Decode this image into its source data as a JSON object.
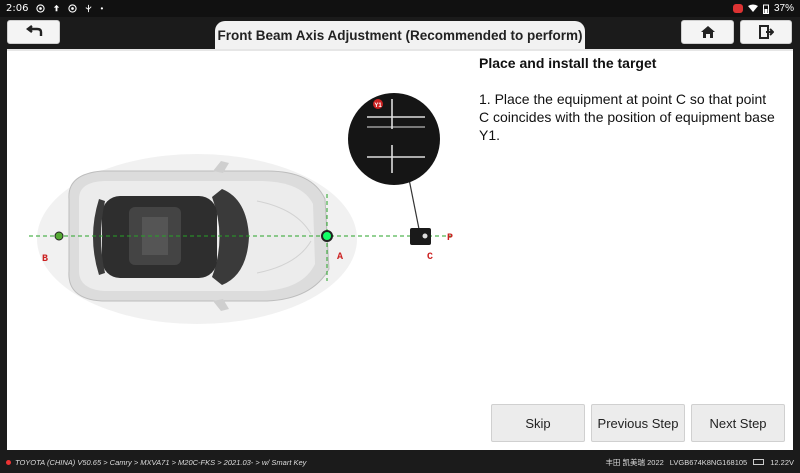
{
  "status_bar": {
    "time": "2:06",
    "battery": "37%"
  },
  "header": {
    "title": "Front Beam Axis Adjustment (Recommended to perform)"
  },
  "instructions": {
    "title": "Place and install the target",
    "text": "1. Place the equipment at point C so that point C coincides with the position of equipment base Y1."
  },
  "diagram": {
    "label_b": "B",
    "label_a": "A",
    "label_c": "C",
    "label_p": "P",
    "marker_y1": "Y1"
  },
  "buttons": {
    "skip": "Skip",
    "previous": "Previous Step",
    "next": "Next Step"
  },
  "footer": {
    "breadcrumb": "TOYOTA (CHINA) V50.65 > Camry > MXVA71 > M20C-FKS > 2021.03- > w/ Smart Key",
    "vehicle": "丰田 凯美瑞 2022",
    "vin": "LVGB674K8NG168105",
    "voltage": "12.22V"
  },
  "colors": {
    "guide_green": "#27a327",
    "label_red": "#cc2222",
    "background_dark": "#1b1b1b"
  }
}
